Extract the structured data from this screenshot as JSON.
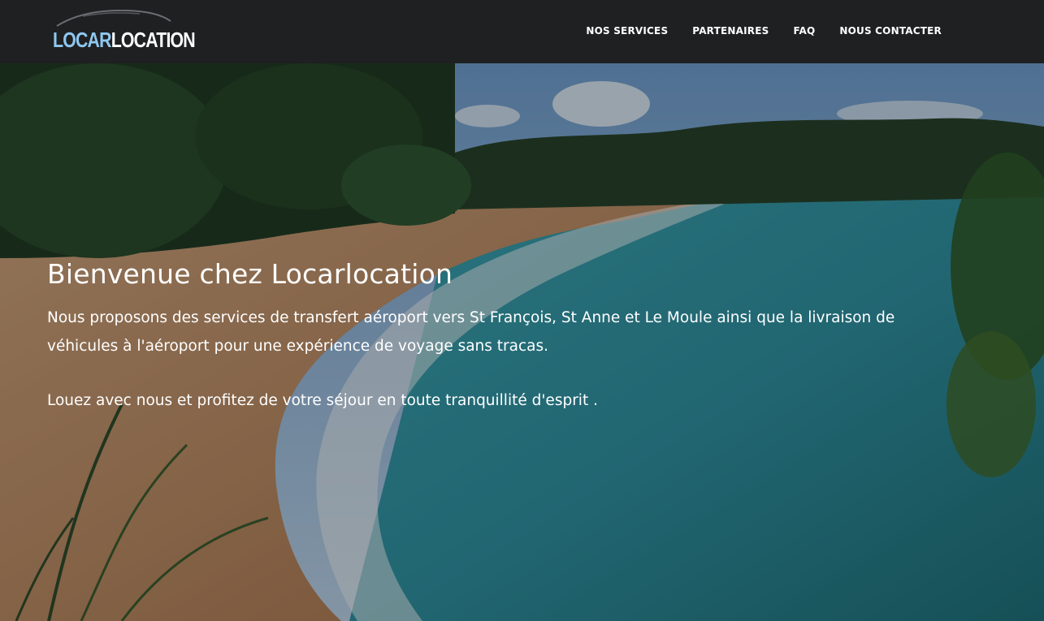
{
  "brand": {
    "logo_part1": "LOCAR",
    "logo_part2": "LOCATION"
  },
  "nav": {
    "items": [
      "NOS SERVICES",
      "PARTENAIRES",
      "FAQ",
      "NOUS CONTACTER"
    ]
  },
  "hero": {
    "title": "Bienvenue chez Locarlocation",
    "paragraph1": "Nous proposons des services de transfert aéroport vers St François, St Anne et Le Moule ainsi que la livraison de véhicules à l'aéroport pour une expérience de voyage sans tracas.",
    "paragraph2": "Louez avec nous et profitez de votre séjour en toute tranquillité d'esprit ."
  },
  "colors": {
    "navbar_bg": "#1f2022",
    "logo_accent": "#8ec8f0",
    "text": "#ffffff"
  }
}
